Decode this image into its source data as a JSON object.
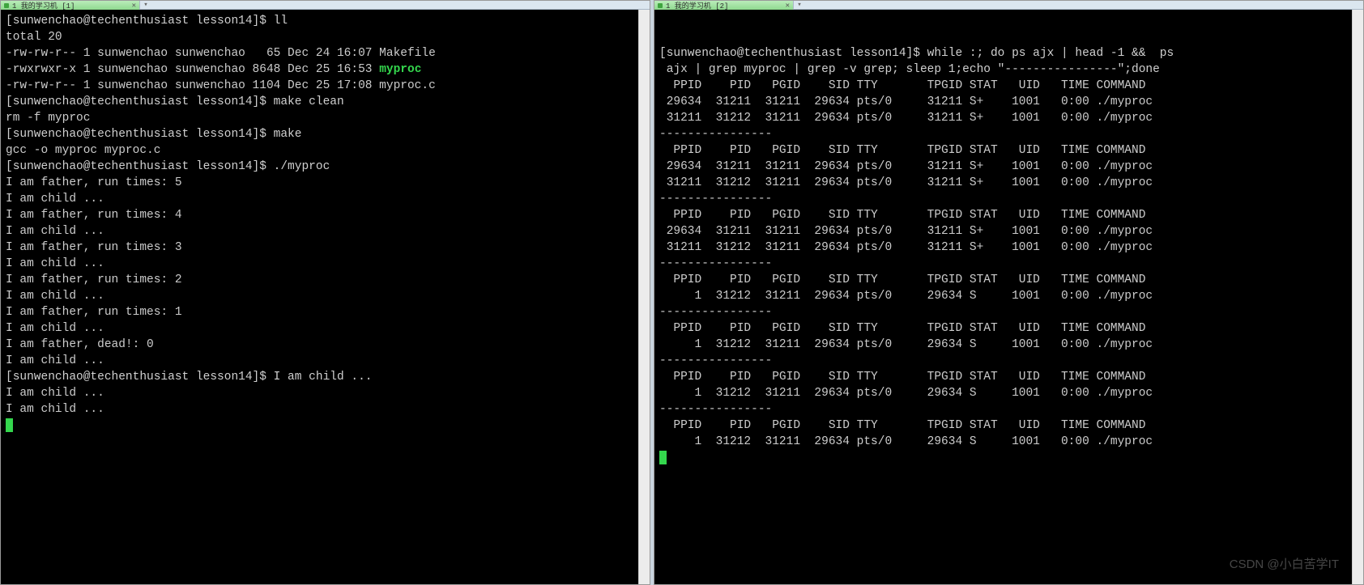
{
  "watermark": "CSDN @小白苦学IT",
  "left": {
    "tab": "1 我的学习机 [1]",
    "prompt": "[sunwenchao@techenthusiast lesson14]$ ",
    "lines": [
      {
        "t": "p",
        "cmd": "ll"
      },
      {
        "t": "o",
        "txt": "total 20"
      },
      {
        "t": "o",
        "txt": "-rw-rw-r-- 1 sunwenchao sunwenchao   65 Dec 24 16:07 Makefile"
      },
      {
        "t": "ox",
        "pre": "-rwxrwxr-x 1 sunwenchao sunwenchao 8648 Dec 25 16:53 ",
        "exe": "myproc"
      },
      {
        "t": "o",
        "txt": "-rw-rw-r-- 1 sunwenchao sunwenchao 1104 Dec 25 17:08 myproc.c"
      },
      {
        "t": "p",
        "cmd": "make clean"
      },
      {
        "t": "o",
        "txt": "rm -f myproc"
      },
      {
        "t": "p",
        "cmd": "make"
      },
      {
        "t": "o",
        "txt": "gcc -o myproc myproc.c"
      },
      {
        "t": "p",
        "cmd": "./myproc"
      },
      {
        "t": "o",
        "txt": "I am father, run times: 5"
      },
      {
        "t": "o",
        "txt": "I am child ..."
      },
      {
        "t": "o",
        "txt": "I am father, run times: 4"
      },
      {
        "t": "o",
        "txt": "I am child ..."
      },
      {
        "t": "o",
        "txt": "I am father, run times: 3"
      },
      {
        "t": "o",
        "txt": "I am child ..."
      },
      {
        "t": "o",
        "txt": "I am father, run times: 2"
      },
      {
        "t": "o",
        "txt": "I am child ..."
      },
      {
        "t": "o",
        "txt": "I am father, run times: 1"
      },
      {
        "t": "o",
        "txt": "I am child ..."
      },
      {
        "t": "o",
        "txt": "I am father, dead!: 0"
      },
      {
        "t": "o",
        "txt": "I am child ..."
      },
      {
        "t": "p",
        "cmd": "I am child ..."
      },
      {
        "t": "o",
        "txt": "I am child ..."
      },
      {
        "t": "o",
        "txt": "I am child ..."
      },
      {
        "t": "cur"
      }
    ]
  },
  "right": {
    "tab": "1 我的学习机 [2]",
    "prompt": "[sunwenchao@techenthusiast lesson14]$ ",
    "cmd1": "while :; do ps ajx | head -1 &&  ps",
    "cmd2": " ajx | grep myproc | grep -v grep; sleep 1;echo \"----------------\";done",
    "header": "  PPID    PID   PGID    SID TTY       TPGID STAT   UID   TIME COMMAND",
    "sep": "----------------",
    "blocks": [
      [
        " 29634  31211  31211  29634 pts/0     31211 S+    1001   0:00 ./myproc",
        " 31211  31212  31211  29634 pts/0     31211 S+    1001   0:00 ./myproc"
      ],
      [
        " 29634  31211  31211  29634 pts/0     31211 S+    1001   0:00 ./myproc",
        " 31211  31212  31211  29634 pts/0     31211 S+    1001   0:00 ./myproc"
      ],
      [
        " 29634  31211  31211  29634 pts/0     31211 S+    1001   0:00 ./myproc",
        " 31211  31212  31211  29634 pts/0     31211 S+    1001   0:00 ./myproc"
      ],
      [
        "     1  31212  31211  29634 pts/0     29634 S     1001   0:00 ./myproc"
      ],
      [
        "     1  31212  31211  29634 pts/0     29634 S     1001   0:00 ./myproc"
      ],
      [
        "     1  31212  31211  29634 pts/0     29634 S     1001   0:00 ./myproc"
      ],
      [
        "     1  31212  31211  29634 pts/0     29634 S     1001   0:00 ./myproc"
      ]
    ]
  }
}
